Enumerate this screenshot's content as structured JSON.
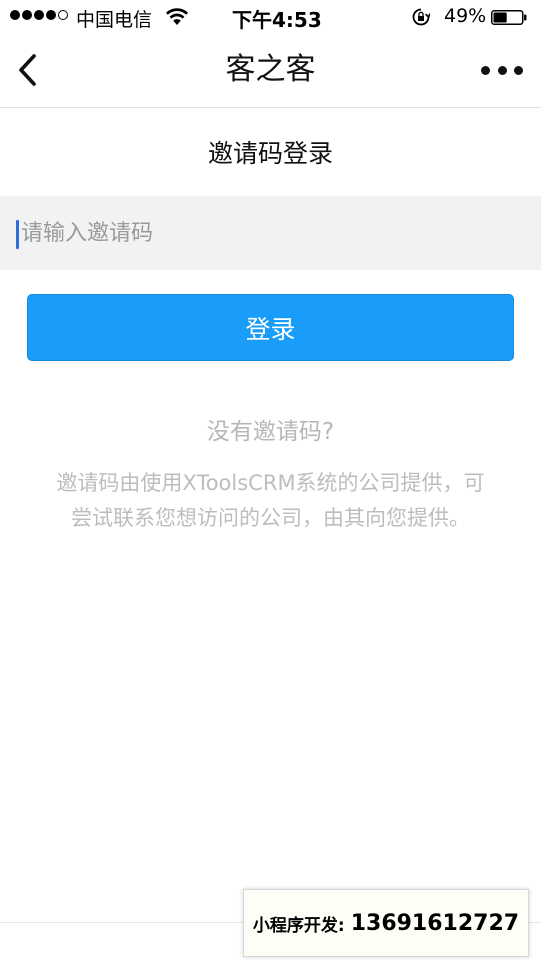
{
  "status_bar": {
    "carrier": "中国电信",
    "time": "下午4:53",
    "battery_percent": "49%",
    "battery_level": 0.49,
    "signal_bars_filled": 4,
    "signal_bars_total": 5
  },
  "nav": {
    "title": "客之客",
    "back_icon": "chevron-left-icon",
    "more_icon": "more-dots-icon"
  },
  "page": {
    "heading": "邀请码登录",
    "input_placeholder": "请输入邀请码",
    "input_value": "",
    "login_label": "登录",
    "no_code_title": "没有邀请码?",
    "no_code_desc": "邀请码由使用XToolsCRM系统的公司提供，可尝试联系您想访问的公司，由其向您提供。"
  },
  "watermark": {
    "label": "小程序开发:",
    "phone": "13691612727"
  },
  "colors": {
    "primary": "#1a9cf9",
    "input_bg": "#f2f2f2",
    "muted_text": "#b7b7b7",
    "cursor": "#2f6de1"
  }
}
